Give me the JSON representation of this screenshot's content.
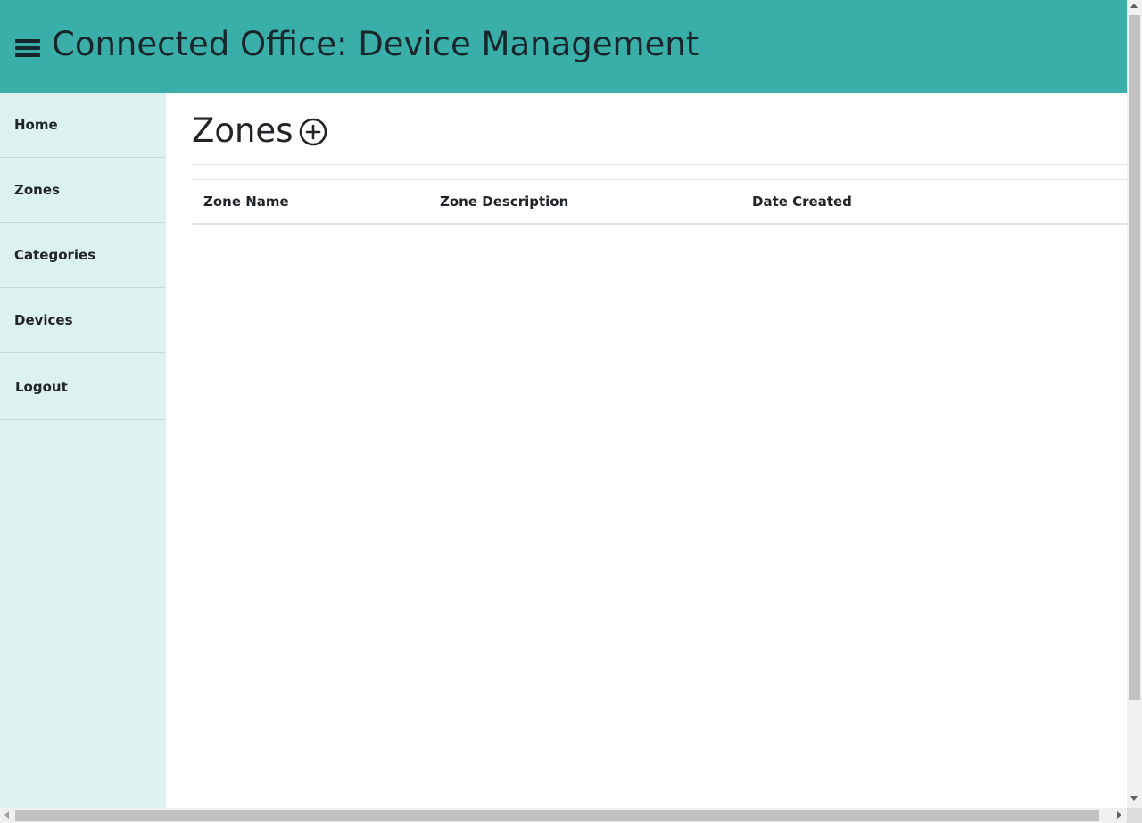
{
  "header": {
    "title": "Connected Office: Device Management",
    "background_color": "#3aaea9",
    "menu_icon": "hamburger-menu-icon"
  },
  "sidebar": {
    "background_color": "#dcf2f0",
    "items": [
      {
        "label": "Home"
      },
      {
        "label": "Zones"
      },
      {
        "label": "Categories"
      },
      {
        "label": "Devices"
      },
      {
        "label": "Logout"
      }
    ]
  },
  "main": {
    "page_title": "Zones",
    "add_icon": "plus-circle-icon",
    "table": {
      "columns": [
        "Zone Name",
        "Zone Description",
        "Date Created"
      ],
      "rows": []
    }
  }
}
